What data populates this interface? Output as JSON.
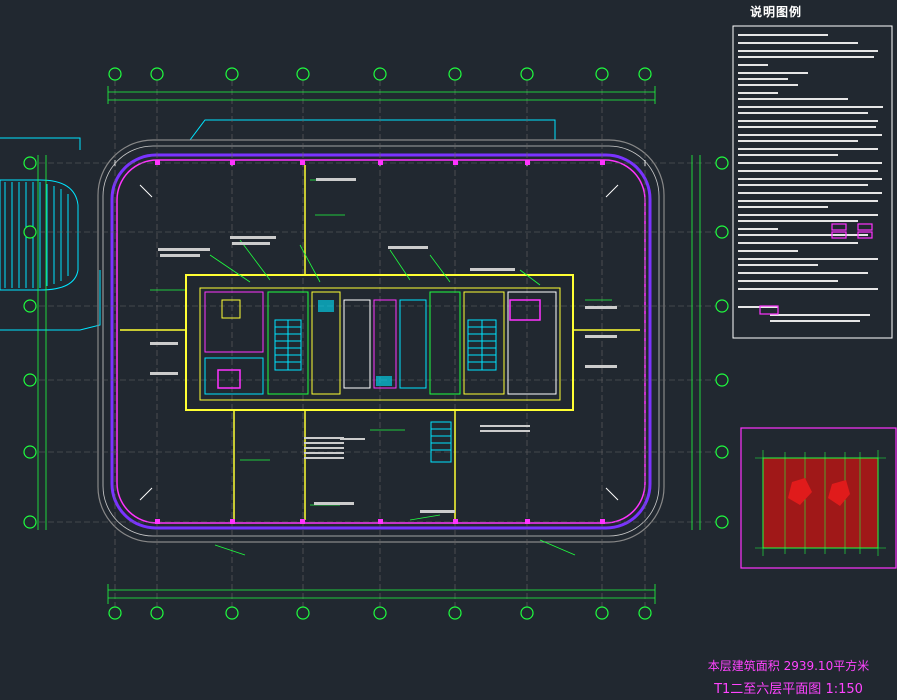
{
  "drawing": {
    "notes_title": "说明图例",
    "area_note": "本层建筑面积 2939.10平方米",
    "plan_title": "T1二至六层平面图 1:150"
  },
  "colors": {
    "background": "#212830",
    "axis": "#1fff3f",
    "core_yellow": "#ffff33",
    "magenta": "#ff33ff",
    "cyan": "#00e5ff",
    "red_zone": "#a01818",
    "text_white": "#ffffff"
  },
  "icons": {
    "axis_bubble": "circle",
    "stair": "stair-hatch",
    "entrance_canopy": "hatched-ramp"
  }
}
